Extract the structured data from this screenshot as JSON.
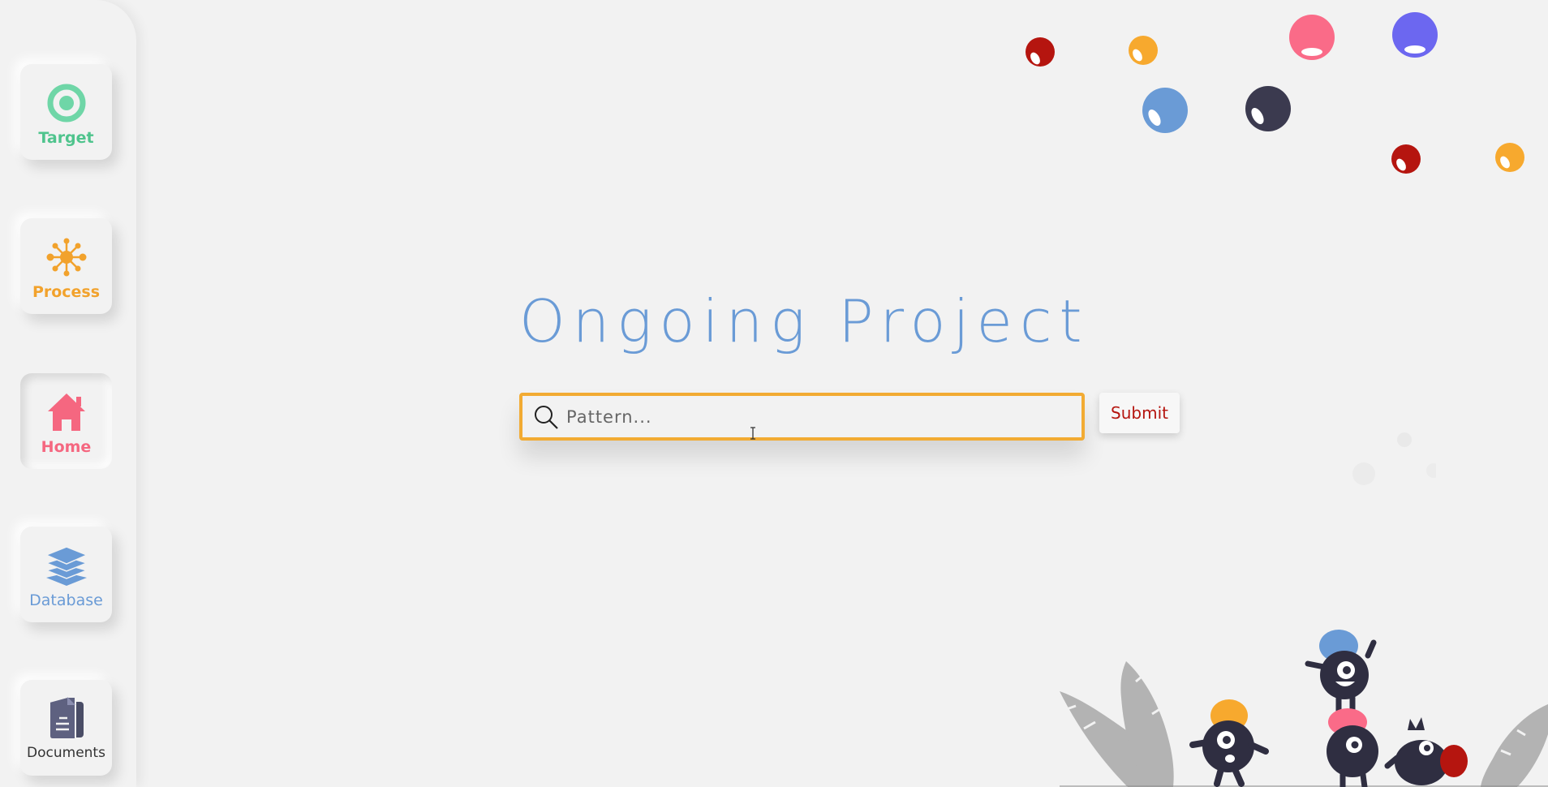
{
  "sidebar": {
    "items": [
      {
        "label": "Target",
        "icon": "target-icon",
        "color": "#5ccf9a"
      },
      {
        "label": "Process",
        "icon": "network-icon",
        "color": "#f2a22c"
      },
      {
        "label": "Home",
        "icon": "home-icon",
        "color": "#f56780",
        "active": true
      },
      {
        "label": "Database",
        "icon": "layers-icon",
        "color": "#6a9bd6"
      },
      {
        "label": "Documents",
        "icon": "documents-icon",
        "color": "#4a4d66"
      }
    ]
  },
  "main": {
    "title": "Ongoing Project",
    "search": {
      "placeholder": "Pattern...",
      "value": ""
    },
    "submit_label": "Submit"
  },
  "colors": {
    "background": "#f2f2f2",
    "title": "#6a9bd6",
    "search_border": "#f2ab33",
    "submit_text": "#b5150f",
    "bubble_red": "#b5150f",
    "bubble_orange": "#f7a92e",
    "bubble_pink": "#fa6b88",
    "bubble_purple": "#6c67f0",
    "bubble_blue": "#6a9bd6",
    "bubble_navy": "#3b3a4f",
    "leaf_gray": "#b3b3b3",
    "monster_dark": "#2f2e41"
  }
}
